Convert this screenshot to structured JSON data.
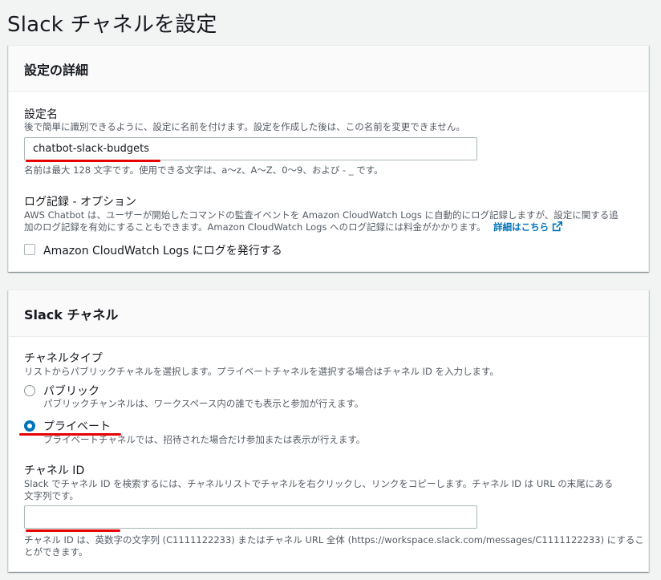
{
  "page": {
    "title": "Slack チャネルを設定"
  },
  "config_section": {
    "header": "設定の詳細",
    "name_field": {
      "label": "設定名",
      "description": "後で簡単に識別できるように、設定に名前を付けます。設定を作成した後は、この名前を変更できません。",
      "value": "chatbot-slack-budgets",
      "constraint": "名前は最大 128 文字です。使用できる文字は、a〜z、A〜Z、0〜9、および - _ です。"
    },
    "logging": {
      "label": "ログ記録 - オプション",
      "description_line1": "AWS Chatbot は、ユーザーが開始したコマンドの監査イベントを Amazon CloudWatch Logs に自動的にログ記録しますが、設定に関する追",
      "description_line2": "加のログ記録を有効にすることもできます。Amazon CloudWatch Logs へのログ記録には料金がかかります。",
      "link_text": "詳細はこちら",
      "checkbox_label": "Amazon CloudWatch Logs にログを発行する",
      "checkbox_checked": false
    }
  },
  "slack_section": {
    "header": "Slack チャネル",
    "channel_type": {
      "label": "チャネルタイプ",
      "description": "リストからパブリックチャネルを選択します。プライベートチャネルを選択する場合はチャネル ID を入力します。",
      "options": [
        {
          "label": "パブリック",
          "description": "パブリックチャンネルは、ワークスペース内の誰でも表示と参加が行えます。",
          "selected": false
        },
        {
          "label": "プライベート",
          "description": "プライベートチャネルでは、招待された場合だけ参加または表示が行えます。",
          "selected": true
        }
      ]
    },
    "channel_id": {
      "label": "チャネル ID",
      "description_line1": "Slack でチャネル ID を検索するには、チャネルリストでチャネルを右クリックし、リンクをコピーします。チャネル ID は URL の末尾にある",
      "description_line2": "文字列です。",
      "value": "",
      "hint_line1": "チャネル ID は、英数字の文字列 (C1111122233) またはチャネル URL 全体 (https://workspace.slack.com/messages/C1111122233) にするこ",
      "hint_line2": "とができます。"
    }
  },
  "colors": {
    "accent": "#0073bb",
    "annotation_underline": "#e60000",
    "background": "#f2f3f3"
  }
}
